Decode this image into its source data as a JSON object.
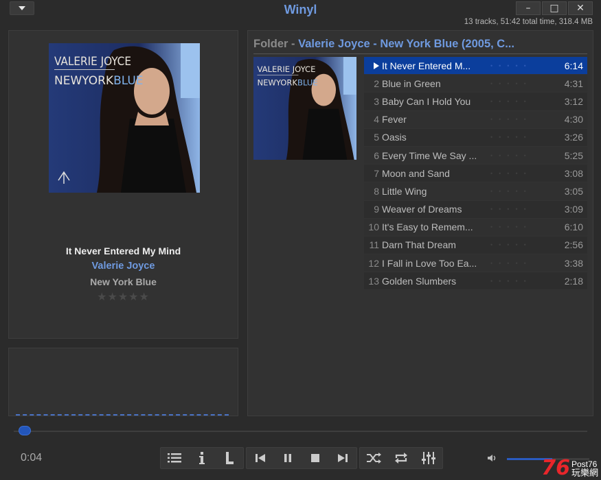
{
  "window": {
    "title": "Winyl",
    "minimize": "–",
    "maximize": "□",
    "close": "✕"
  },
  "stats": "13 tracks, 51:42 total time, 318.4 MB",
  "now_playing": {
    "title": "It Never Entered My Mind",
    "artist": "Valerie Joyce",
    "album": "New York Blue",
    "rating_stars": 0,
    "rating_glyphs": "★★★★★"
  },
  "album_art": {
    "artist_text": "VALERIE JOYCE",
    "album_prefix": "NEWYORK",
    "album_suffix": "BLUE"
  },
  "playlist": {
    "folder_label": "Folder",
    "separator": " - ",
    "folder_name": "Valerie Joyce - New York Blue (2005, C...",
    "tracks": [
      {
        "num": "",
        "title": "It Never Entered M...",
        "duration": "6:14",
        "active": true
      },
      {
        "num": "2",
        "title": "Blue in Green",
        "duration": "4:31"
      },
      {
        "num": "3",
        "title": "Baby Can I Hold You",
        "duration": "3:12"
      },
      {
        "num": "4",
        "title": "Fever",
        "duration": "4:30"
      },
      {
        "num": "5",
        "title": "Oasis",
        "duration": "3:26"
      },
      {
        "num": "6",
        "title": "Every Time We Say ...",
        "duration": "5:25"
      },
      {
        "num": "7",
        "title": "Moon and Sand",
        "duration": "3:08"
      },
      {
        "num": "8",
        "title": "Little Wing",
        "duration": "3:05"
      },
      {
        "num": "9",
        "title": "Weaver of Dreams",
        "duration": "3:09"
      },
      {
        "num": "10",
        "title": "It's Easy to Remem...",
        "duration": "6:10"
      },
      {
        "num": "11",
        "title": "Darn That Dream",
        "duration": "2:56"
      },
      {
        "num": "12",
        "title": "I Fall in Love Too Ea...",
        "duration": "3:38"
      },
      {
        "num": "13",
        "title": "Golden Slumbers",
        "duration": "2:18"
      }
    ],
    "rating_dots": "•••••"
  },
  "player": {
    "elapsed": "0:04",
    "progress_fraction": 0.01,
    "volume_fraction": 0.55
  },
  "watermark": {
    "number": "76",
    "brand": "Post76",
    "chinese": "玩樂網"
  },
  "colors": {
    "accent": "#6f9ae0",
    "selection": "#0b3e9c",
    "background": "#2b2b2b",
    "panel": "#323232"
  }
}
